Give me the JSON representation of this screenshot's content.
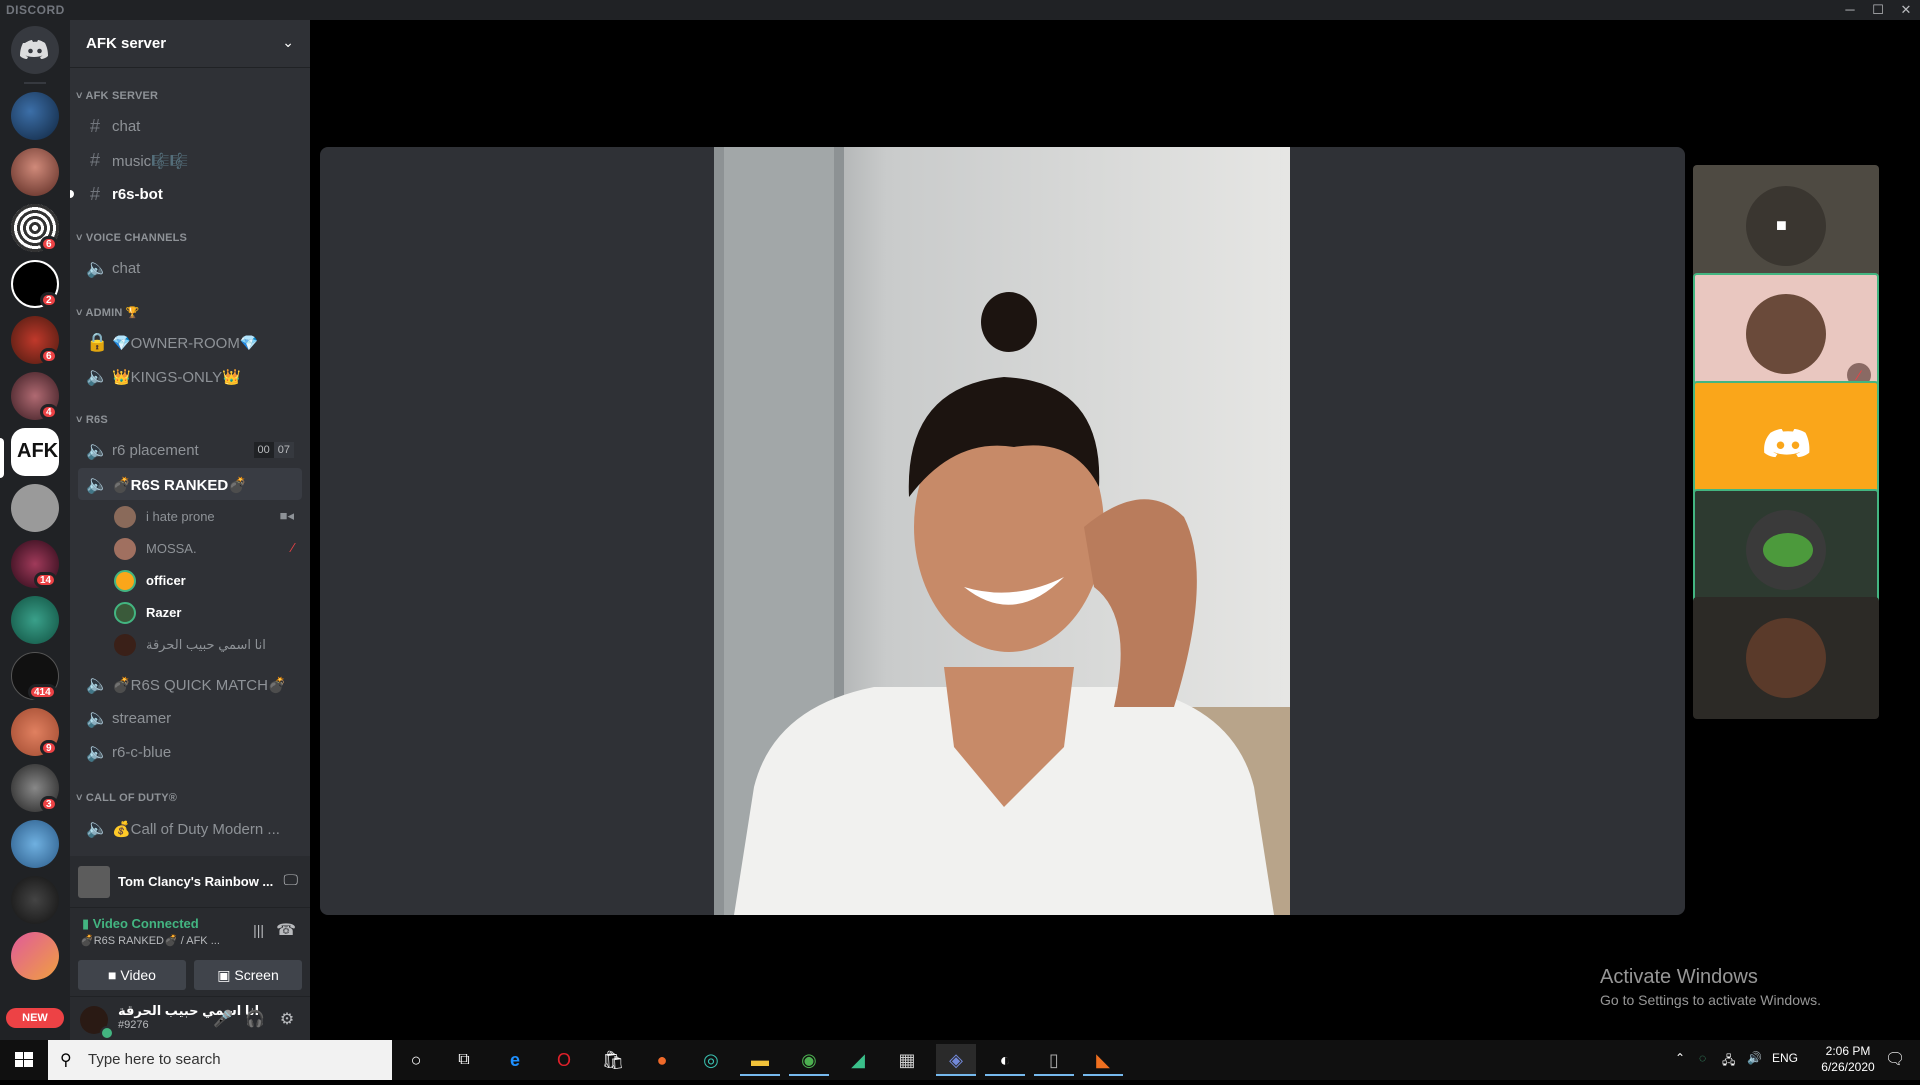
{
  "app": {
    "brand": "DISCORD"
  },
  "window_controls": {
    "minimize": "─",
    "maximize": "☐",
    "close": "✕"
  },
  "guilds": {
    "badges": [
      "6",
      "2",
      "6",
      "4",
      "14",
      "414",
      "9",
      "3"
    ],
    "new_label": "NEW"
  },
  "server": {
    "name": "AFK server",
    "dropdown_icon": "chevron-down-icon"
  },
  "categories": {
    "afk": "AFK SERVER",
    "voice": "VOICE CHANNELS",
    "admin": "ADMIN 🏆",
    "r6s": "R6S",
    "cod": "CALL OF DUTY®"
  },
  "channels": {
    "chat_text": "chat",
    "music": "music🎼🎼",
    "r6s_bot": "r6s-bot",
    "voice_chat": "chat",
    "owner_room": "💎OWNER-ROOM💎",
    "kings_only": "👑KINGS-ONLY👑",
    "r6_placement": "r6 placement",
    "r6_placement_count": [
      "00",
      "07"
    ],
    "r6s_ranked": "💣R6S RANKED💣",
    "r6s_quick": "💣R6S QUICK MATCH💣",
    "streamer": "streamer",
    "r6_c_blue": "r6-c-blue",
    "cod_mw": "💰Call of Duty Modern ..."
  },
  "voice_users": [
    {
      "name": "i hate prone",
      "status_icon": "video-icon"
    },
    {
      "name": "MOSSA.",
      "status_icon": "muted-icon"
    },
    {
      "name": "officer",
      "status_icon": ""
    },
    {
      "name": "Razer",
      "status_icon": ""
    },
    {
      "name": "انا اسمي حبيب الحرقة",
      "status_icon": ""
    }
  ],
  "activity": {
    "game": "Tom Clancy's Rainbow ...",
    "icon": "monitor-icon"
  },
  "rtc": {
    "status": "Video Connected",
    "channel": "💣R6S RANKED💣 / AFK ...",
    "video_btn": "Video",
    "screen_btn": "Screen"
  },
  "user": {
    "name": "انا اسمي حبيب الحرقة",
    "tag": "#9276"
  },
  "watermark": {
    "line1": "Activate Windows",
    "line2": "Go to Settings to activate Windows."
  },
  "taskbar": {
    "search_placeholder": "Type here to search",
    "lang": "ENG",
    "time": "2:06 PM",
    "date": "6/26/2020"
  },
  "colors": {
    "accent": "#43b581",
    "badge": "#ed4245",
    "discord_orange": "#faa61a"
  }
}
